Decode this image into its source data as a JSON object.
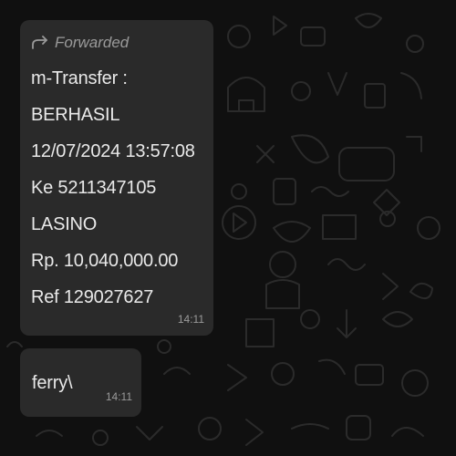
{
  "messages": [
    {
      "forwarded_label": "Forwarded",
      "forwarded_icon": "forward-arrow-icon",
      "lines": [
        "m-Transfer :",
        "BERHASIL",
        "12/07/2024 13:57:08",
        "Ke 5211347105",
        "LASINO",
        "Rp. 10,040,000.00",
        "Ref 129027627"
      ],
      "time": "14:11"
    },
    {
      "text": "ferry\\",
      "time": "14:11"
    }
  ],
  "colors": {
    "background": "#101010",
    "bubble": "#2a2a2a",
    "text": "#e9e9e9",
    "meta": "#9a9a9a"
  }
}
